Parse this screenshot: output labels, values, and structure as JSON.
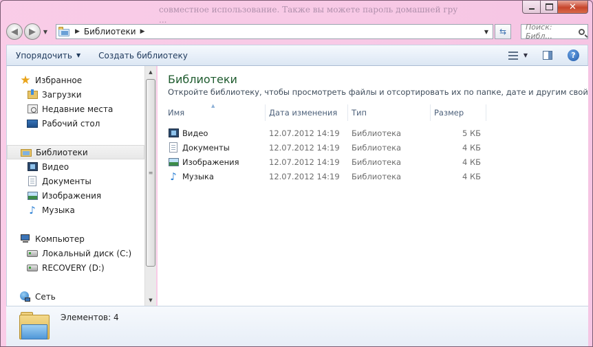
{
  "background_text": [
    "совместное использование. Также вы можете пароль домашней гру",
    "..."
  ],
  "address_bar": {
    "location": "Библиотеки",
    "search_placeholder": "Поиск: Библ..."
  },
  "toolbar": {
    "organize_label": "Упорядочить",
    "new_library_label": "Создать библиотеку"
  },
  "nav": {
    "favorites": "Избранное",
    "downloads": "Загрузки",
    "recent": "Недавние места",
    "desktop": "Рабочий стол",
    "libraries": "Библиотеки",
    "lib_video": "Видео",
    "lib_documents": "Документы",
    "lib_pictures": "Изображения",
    "lib_music": "Музыка",
    "computer": "Компьютер",
    "local_disk": "Локальный диск (C:)",
    "recovery": "RECOVERY (D:)",
    "network": "Сеть"
  },
  "content": {
    "title": "Библиотеки",
    "subtitle": "Откройте библиотеку, чтобы просмотреть файлы и отсортировать их по папке, дате и другим свойства...",
    "columns": {
      "name": "Имя",
      "date": "Дата изменения",
      "type": "Тип",
      "size": "Размер"
    },
    "rows": [
      {
        "name": "Видео",
        "date": "12.07.2012 14:19",
        "type": "Библиотека",
        "size": "5 КБ",
        "icon": "video-library-icon"
      },
      {
        "name": "Документы",
        "date": "12.07.2012 14:19",
        "type": "Библиотека",
        "size": "4 КБ",
        "icon": "documents-library-icon"
      },
      {
        "name": "Изображения",
        "date": "12.07.2012 14:19",
        "type": "Библиотека",
        "size": "4 КБ",
        "icon": "pictures-library-icon"
      },
      {
        "name": "Музыка",
        "date": "12.07.2012 14:19",
        "type": "Библиотека",
        "size": "4 КБ",
        "icon": "music-library-icon"
      }
    ]
  },
  "details": {
    "count": "Элементов: 4"
  },
  "colors": {
    "title_green": "#1e5b2e",
    "window_frame_pink": "#f6c6e4",
    "command_text": "#1e395b"
  }
}
